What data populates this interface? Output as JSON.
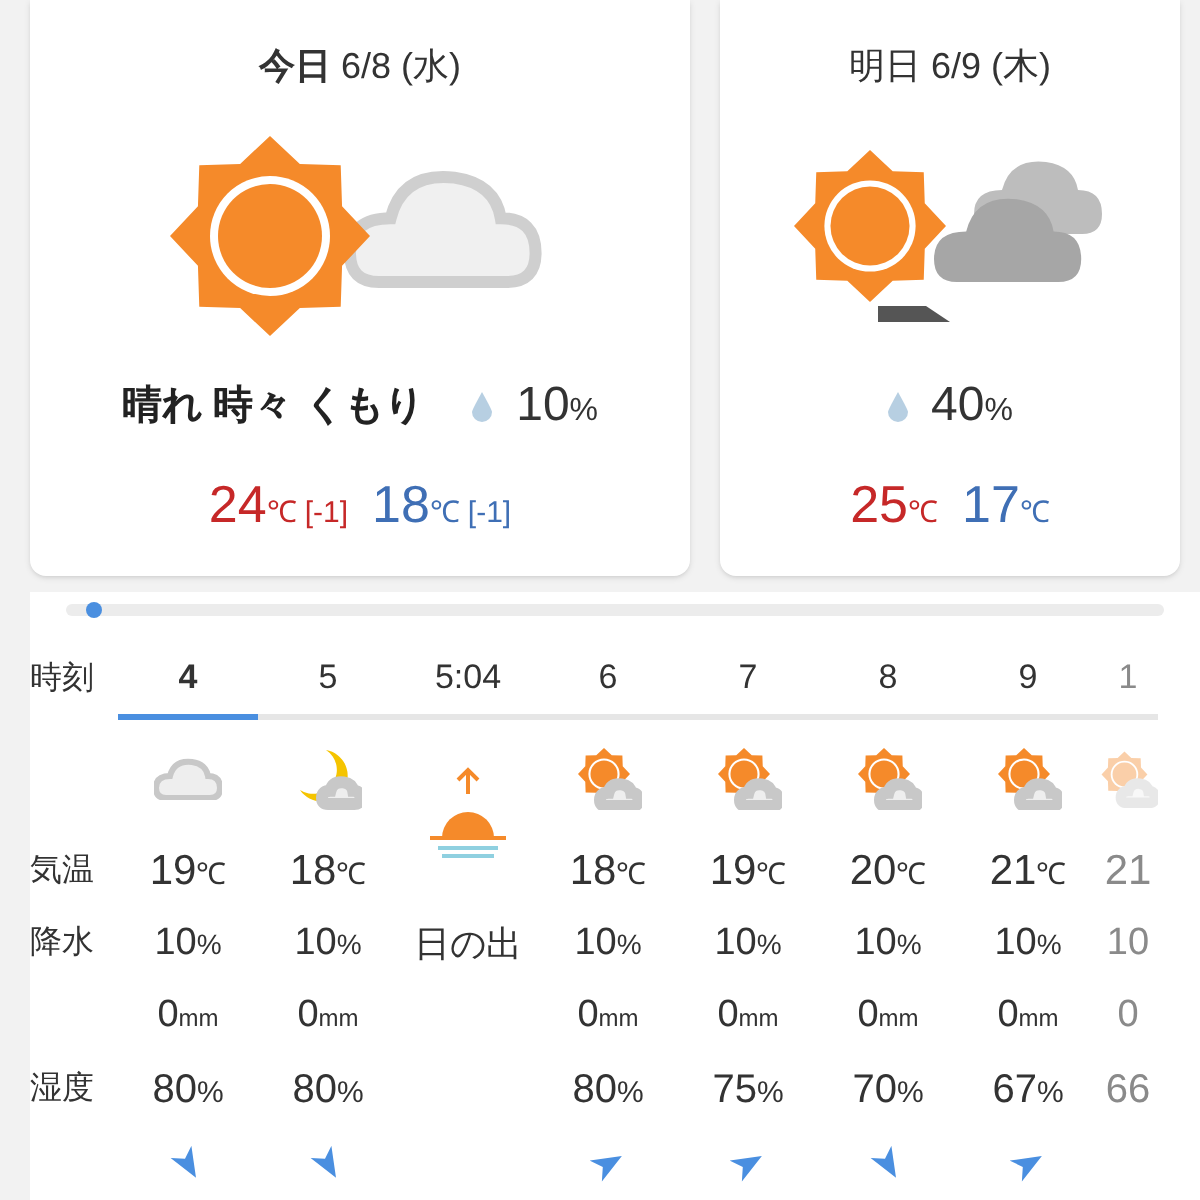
{
  "days": [
    {
      "title": "**今日** 6/8 (水)",
      "icon": {
        "kind": "sun_cloud"
      },
      "weather": "晴れ 時々 くもり",
      "precip": "10%",
      "high": "24℃",
      "high_diff": "[-1]",
      "low": "18℃",
      "low_diff": "[-1]"
    },
    {
      "title": "明日 6/9 (木)",
      "icon": {
        "kind": "sun_clouds_dark"
      },
      "precip": "40%",
      "high": "25℃",
      "low": "17℃"
    }
  ],
  "hourly": {
    "labels": [
      {
        "kind": "time",
        "text": "時刻"
      },
      {
        "kind": "temp",
        "text": "気温"
      },
      {
        "kind": "precip",
        "text": "降水"
      },
      {
        "kind": "rain"
      },
      {
        "kind": "humidity",
        "text": "湿度"
      }
    ],
    "columns": [
      {
        "kind": "hour",
        "time": "4",
        "selected": true,
        "icon": {
          "kind": "cloud"
        },
        "temp": "19℃",
        "precip": "10%",
        "rain": "0mm",
        "humidity": "80%",
        "wind": {
          "kind": "south_east"
        }
      },
      {
        "kind": "hour",
        "time": "5",
        "selected": false,
        "icon": {
          "kind": "moon_cloud"
        },
        "temp": "18℃",
        "precip": "10%",
        "rain": "0mm",
        "humidity": "80%",
        "wind": {
          "kind": "south_east"
        }
      },
      {
        "kind": "sunrise",
        "time": "5:04",
        "selected": false,
        "label": "日の出"
      },
      {
        "kind": "hour",
        "time": "6",
        "selected": false,
        "icon": {
          "kind": "sun_cloud"
        },
        "temp": "18℃",
        "precip": "10%",
        "rain": "0mm",
        "humidity": "80%",
        "wind": {
          "kind": "north_east"
        }
      },
      {
        "kind": "hour",
        "time": "7",
        "selected": false,
        "icon": {
          "kind": "sun_cloud"
        },
        "temp": "19℃",
        "precip": "10%",
        "rain": "0mm",
        "humidity": "75%",
        "wind": {
          "kind": "north_east"
        }
      },
      {
        "kind": "hour",
        "time": "8",
        "selected": false,
        "icon": {
          "kind": "sun_cloud"
        },
        "temp": "20℃",
        "precip": "10%",
        "rain": "0mm",
        "humidity": "70%",
        "wind": {
          "kind": "south_east"
        }
      },
      {
        "kind": "hour",
        "time": "9",
        "selected": false,
        "icon": {
          "kind": "sun_cloud"
        },
        "temp": "21℃",
        "precip": "10%",
        "rain": "0mm",
        "humidity": "67%",
        "wind": {
          "kind": "north_east"
        }
      },
      {
        "kind": "faded",
        "time": "1",
        "selected": false,
        "icon": {
          "kind": "sun_cloud"
        },
        "temp": "21",
        "precip": "10",
        "rain": "0",
        "humidity": "66"
      }
    ]
  }
}
